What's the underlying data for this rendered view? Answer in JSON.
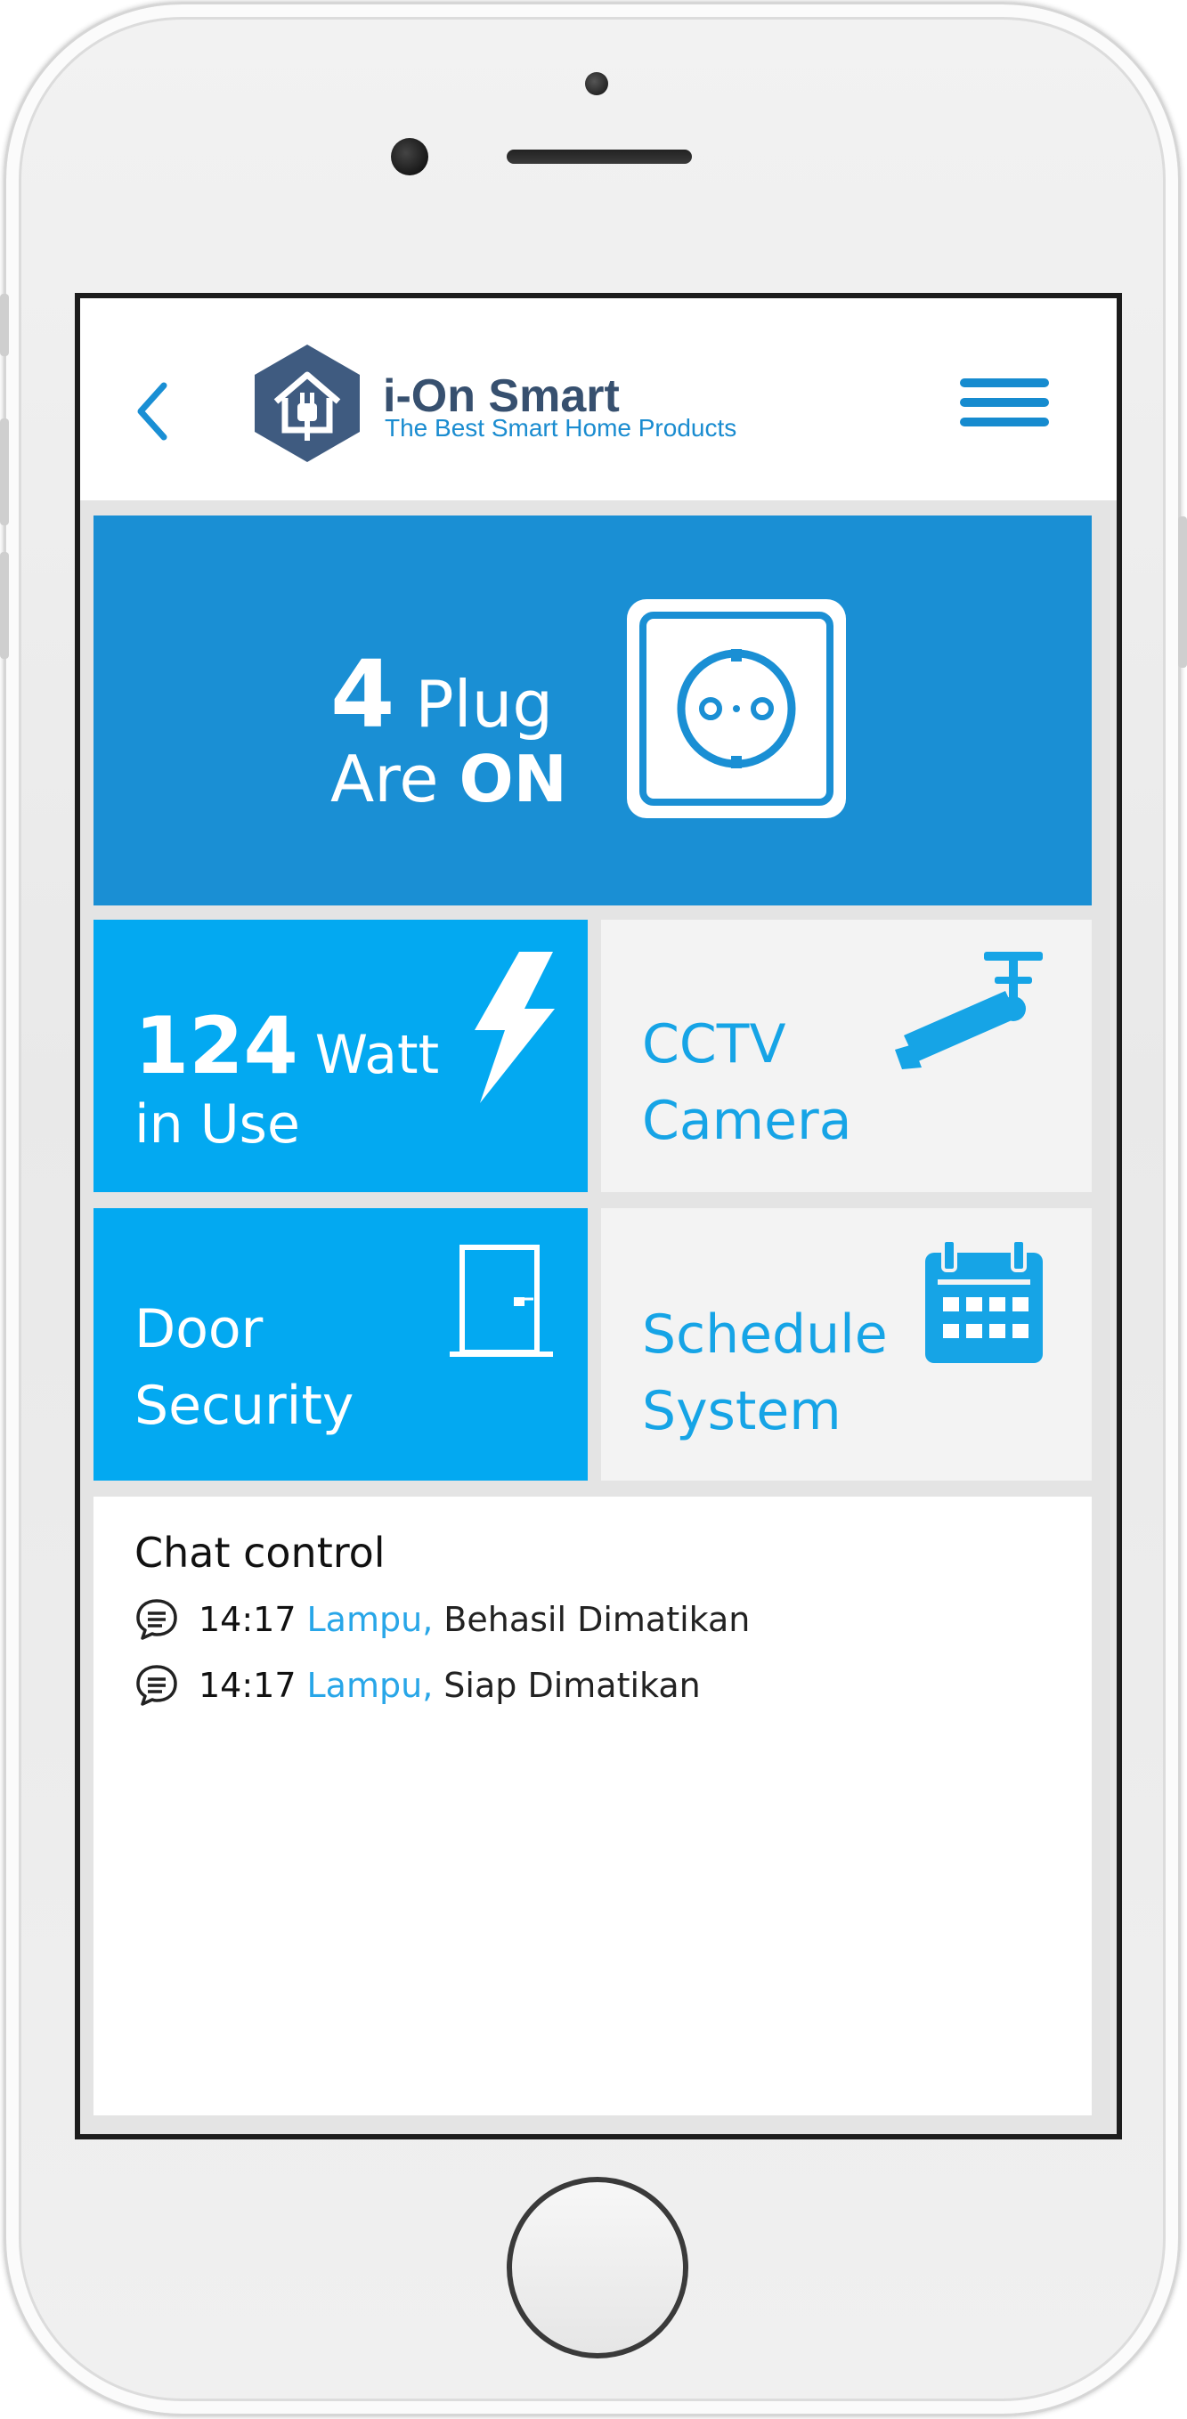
{
  "app": {
    "brand_title": "i-On Smart",
    "brand_tagline": "The Best Smart Home Products",
    "back_icon": "chevron-left-icon",
    "menu_icon": "hamburger-menu-icon",
    "accent_color": "#1a8fd4",
    "tile_color": "#03a9f1"
  },
  "plugs": {
    "count": "4",
    "label": "Plug",
    "line2_prefix": "Are",
    "line2_state": "ON",
    "icon": "power-socket-icon"
  },
  "tiles": {
    "watt": {
      "value": "124",
      "unit": "Watt",
      "line2": "in Use",
      "icon": "lightning-bolt-icon"
    },
    "cctv": {
      "line1": "CCTV",
      "line2": "Camera",
      "icon": "cctv-camera-icon"
    },
    "door": {
      "line1": "Door",
      "line2": "Security",
      "icon": "door-icon"
    },
    "schedule": {
      "line1": "Schedule",
      "line2": "System",
      "icon": "calendar-icon"
    }
  },
  "chat": {
    "title": "Chat control",
    "messages": [
      {
        "time": "14:17",
        "device": "Lampu,",
        "text": "Behasil Dimatikan"
      },
      {
        "time": "14:17",
        "device": "Lampu,",
        "text": "Siap Dimatikan"
      }
    ]
  }
}
